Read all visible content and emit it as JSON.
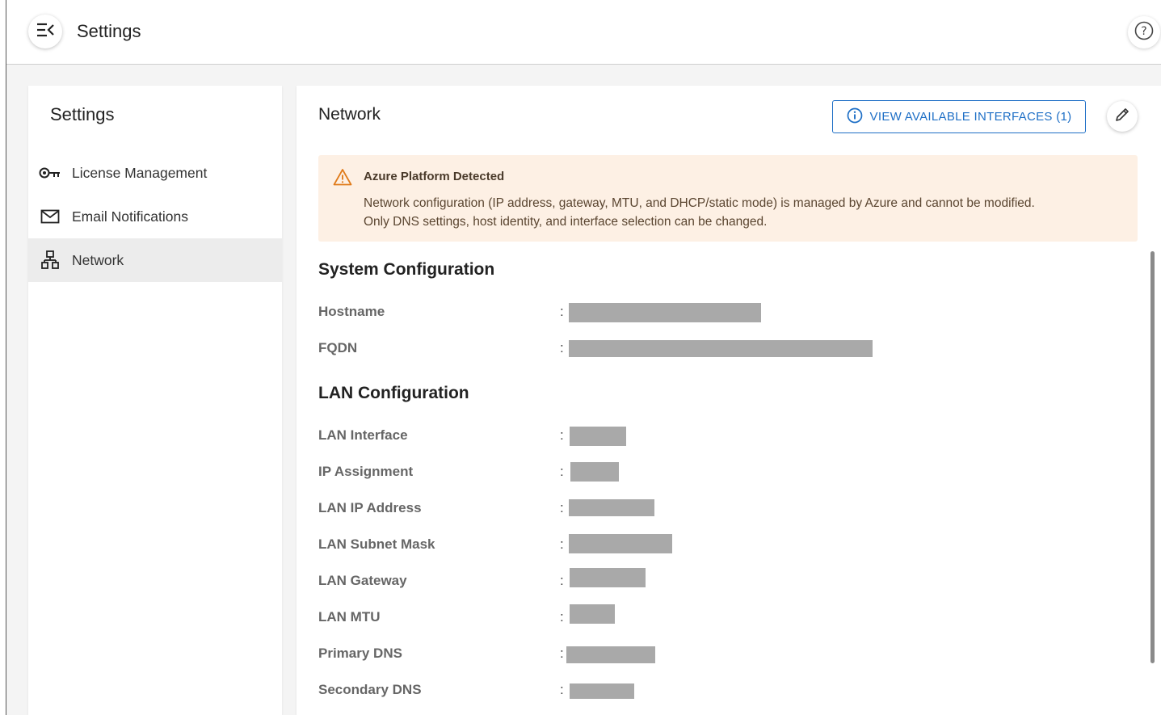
{
  "topbar": {
    "title": "Settings"
  },
  "sidebar": {
    "title": "Settings",
    "items": [
      {
        "label": "License Management",
        "icon": "key-icon"
      },
      {
        "label": "Email Notifications",
        "icon": "mail-icon"
      },
      {
        "label": "Network",
        "icon": "network-icon",
        "active": true
      }
    ]
  },
  "main": {
    "title": "Network",
    "view_interfaces_label": "VIEW AVAILABLE INTERFACES (1)",
    "alert": {
      "title": "Azure Platform Detected",
      "line1": "Network configuration (IP address, gateway, MTU, and DHCP/static mode) is managed by Azure and cannot be modified.",
      "line2": "Only DNS settings, host identity, and interface selection can be changed."
    },
    "system_section_title": "System Configuration",
    "system_fields": [
      {
        "label": "Hostname",
        "colon": ":",
        "value": ""
      },
      {
        "label": "FQDN",
        "colon": ":",
        "value": ""
      }
    ],
    "lan_section_title": "LAN Configuration",
    "lan_fields": [
      {
        "label": "LAN Interface",
        "colon": ":",
        "value": ""
      },
      {
        "label": "IP Assignment",
        "colon": ":",
        "value": ""
      },
      {
        "label": "LAN IP Address",
        "colon": ":",
        "value": ""
      },
      {
        "label": "LAN Subnet Mask",
        "colon": ":",
        "value": ""
      },
      {
        "label": "LAN Gateway",
        "colon": ":",
        "value": ""
      },
      {
        "label": "LAN MTU",
        "colon": ":",
        "value": ""
      },
      {
        "label": "Primary DNS",
        "colon": ":",
        "value": ""
      },
      {
        "label": "Secondary DNS",
        "colon": ":",
        "value": ""
      }
    ]
  },
  "colors": {
    "accent": "#1e6fc6",
    "warning_bg": "#fdf0e4",
    "warning_icon": "#e07b1a",
    "redacted": "#a9a9a9"
  }
}
